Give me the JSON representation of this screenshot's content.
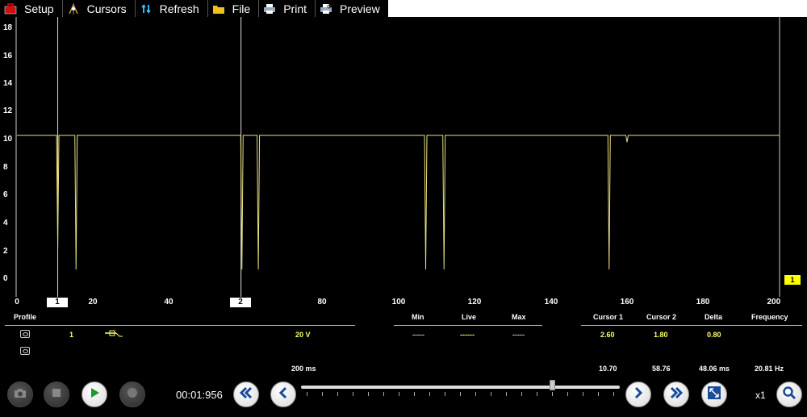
{
  "toolbar": {
    "setup": "Setup",
    "cursors": "Cursors",
    "refresh": "Refresh",
    "file": "File",
    "print": "Print",
    "preview": "Preview"
  },
  "scope": {
    "y_ticks": [
      "18",
      "16",
      "14",
      "12",
      "10",
      "8",
      "6",
      "4",
      "2",
      "0"
    ],
    "x_ticks": [
      "0",
      "20",
      "40",
      "80",
      "100",
      "120",
      "140",
      "160",
      "180",
      "200 ms"
    ],
    "cursor1_label": "1",
    "cursor2_label": "2",
    "channel_badge": "1",
    "trace_color": "#e8e080"
  },
  "chart_data": {
    "type": "line",
    "xlim": [
      0,
      200
    ],
    "ylim": [
      -1,
      19
    ],
    "x_unit": "ms",
    "baseline": 10.5,
    "cursors": [
      {
        "label": "1",
        "x": 10.7
      },
      {
        "label": "2",
        "x": 58.76
      }
    ],
    "dropouts": [
      {
        "x": 10.7,
        "min": 2.4
      },
      {
        "x": 15.5,
        "min": 0.8
      },
      {
        "x": 59.0,
        "min": 0.8
      },
      {
        "x": 63.3,
        "min": 0.8
      },
      {
        "x": 107.2,
        "min": 0.8
      },
      {
        "x": 112.0,
        "min": 0.8
      },
      {
        "x": 155.3,
        "min": 0.8
      },
      {
        "x": 160.0,
        "min": 10.0
      }
    ]
  },
  "info": {
    "profile_header": "Profile",
    "min_header": "Min",
    "live_header": "Live",
    "max_header": "Max",
    "cursor1_header": "Cursor 1",
    "cursor2_header": "Cursor 2",
    "delta_header": "Delta",
    "frequency_header": "Frequency",
    "channel_number": "1",
    "range": "20 V",
    "min_value": "-----",
    "live_value": "------",
    "max_value": "-----",
    "cursor1_value": "2.60",
    "cursor2_value": "1.80",
    "delta_value": "0.80",
    "timebase": "200 ms",
    "cursor1_time": "10.70",
    "cursor2_time": "58.76",
    "delta_time": "48.06 ms",
    "frequency_value": "20.81 Hz"
  },
  "controls": {
    "elapsed_time": "00:01:956",
    "zoom_level": "x1"
  },
  "colors": {
    "accent_yellow": "#ffff00",
    "background": "#000000"
  }
}
